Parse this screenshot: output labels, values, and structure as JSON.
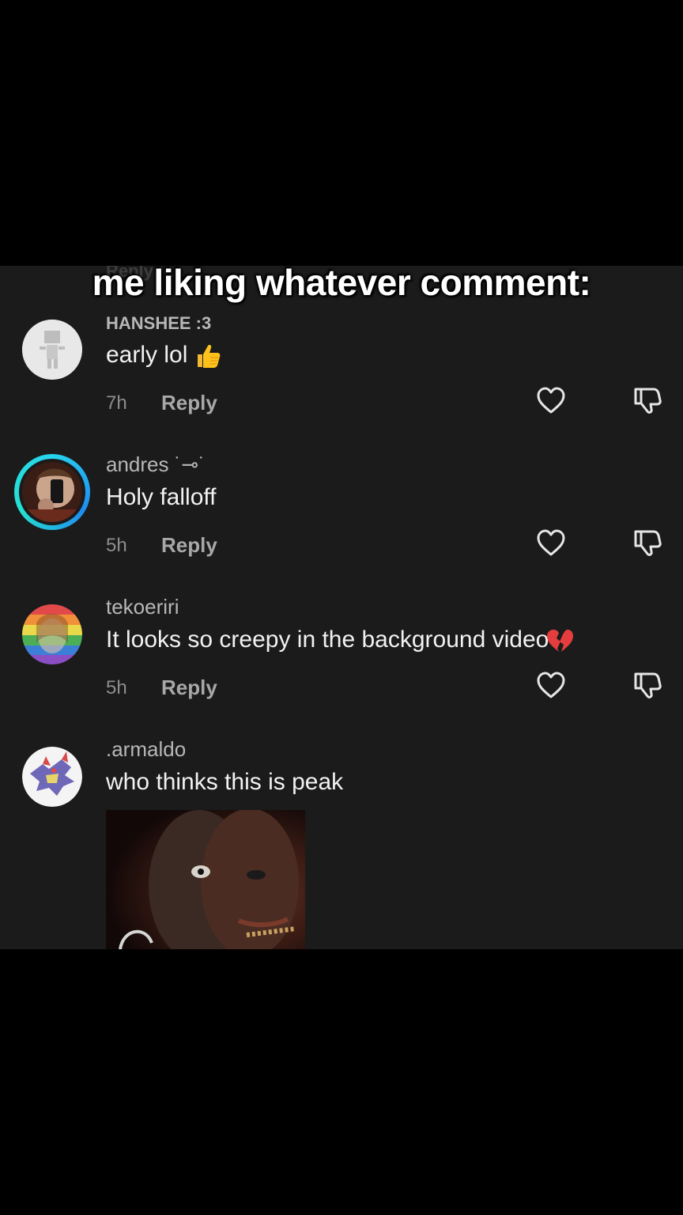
{
  "caption": "me liking whatever comment:",
  "faded_top_text": "Reply",
  "comments": [
    {
      "username": "HANSHEE :3",
      "text": "early lol",
      "emoji": "thumbs-up",
      "time": "7h",
      "reply_label": "Reply"
    },
    {
      "username": "andres ˙⊸˙",
      "text": "Holy falloff",
      "time": "5h",
      "reply_label": "Reply"
    },
    {
      "username": "tekoeriri",
      "text": "It looks so creepy in the background video",
      "emoji": "broken-heart",
      "time": "5h",
      "reply_label": "Reply"
    },
    {
      "username": ".armaldo",
      "text": "who thinks this is peak"
    }
  ],
  "colors": {
    "background": "#1b1b1b",
    "accent_ring": "#27d5ee",
    "muted_text": "#8e8e8e"
  }
}
